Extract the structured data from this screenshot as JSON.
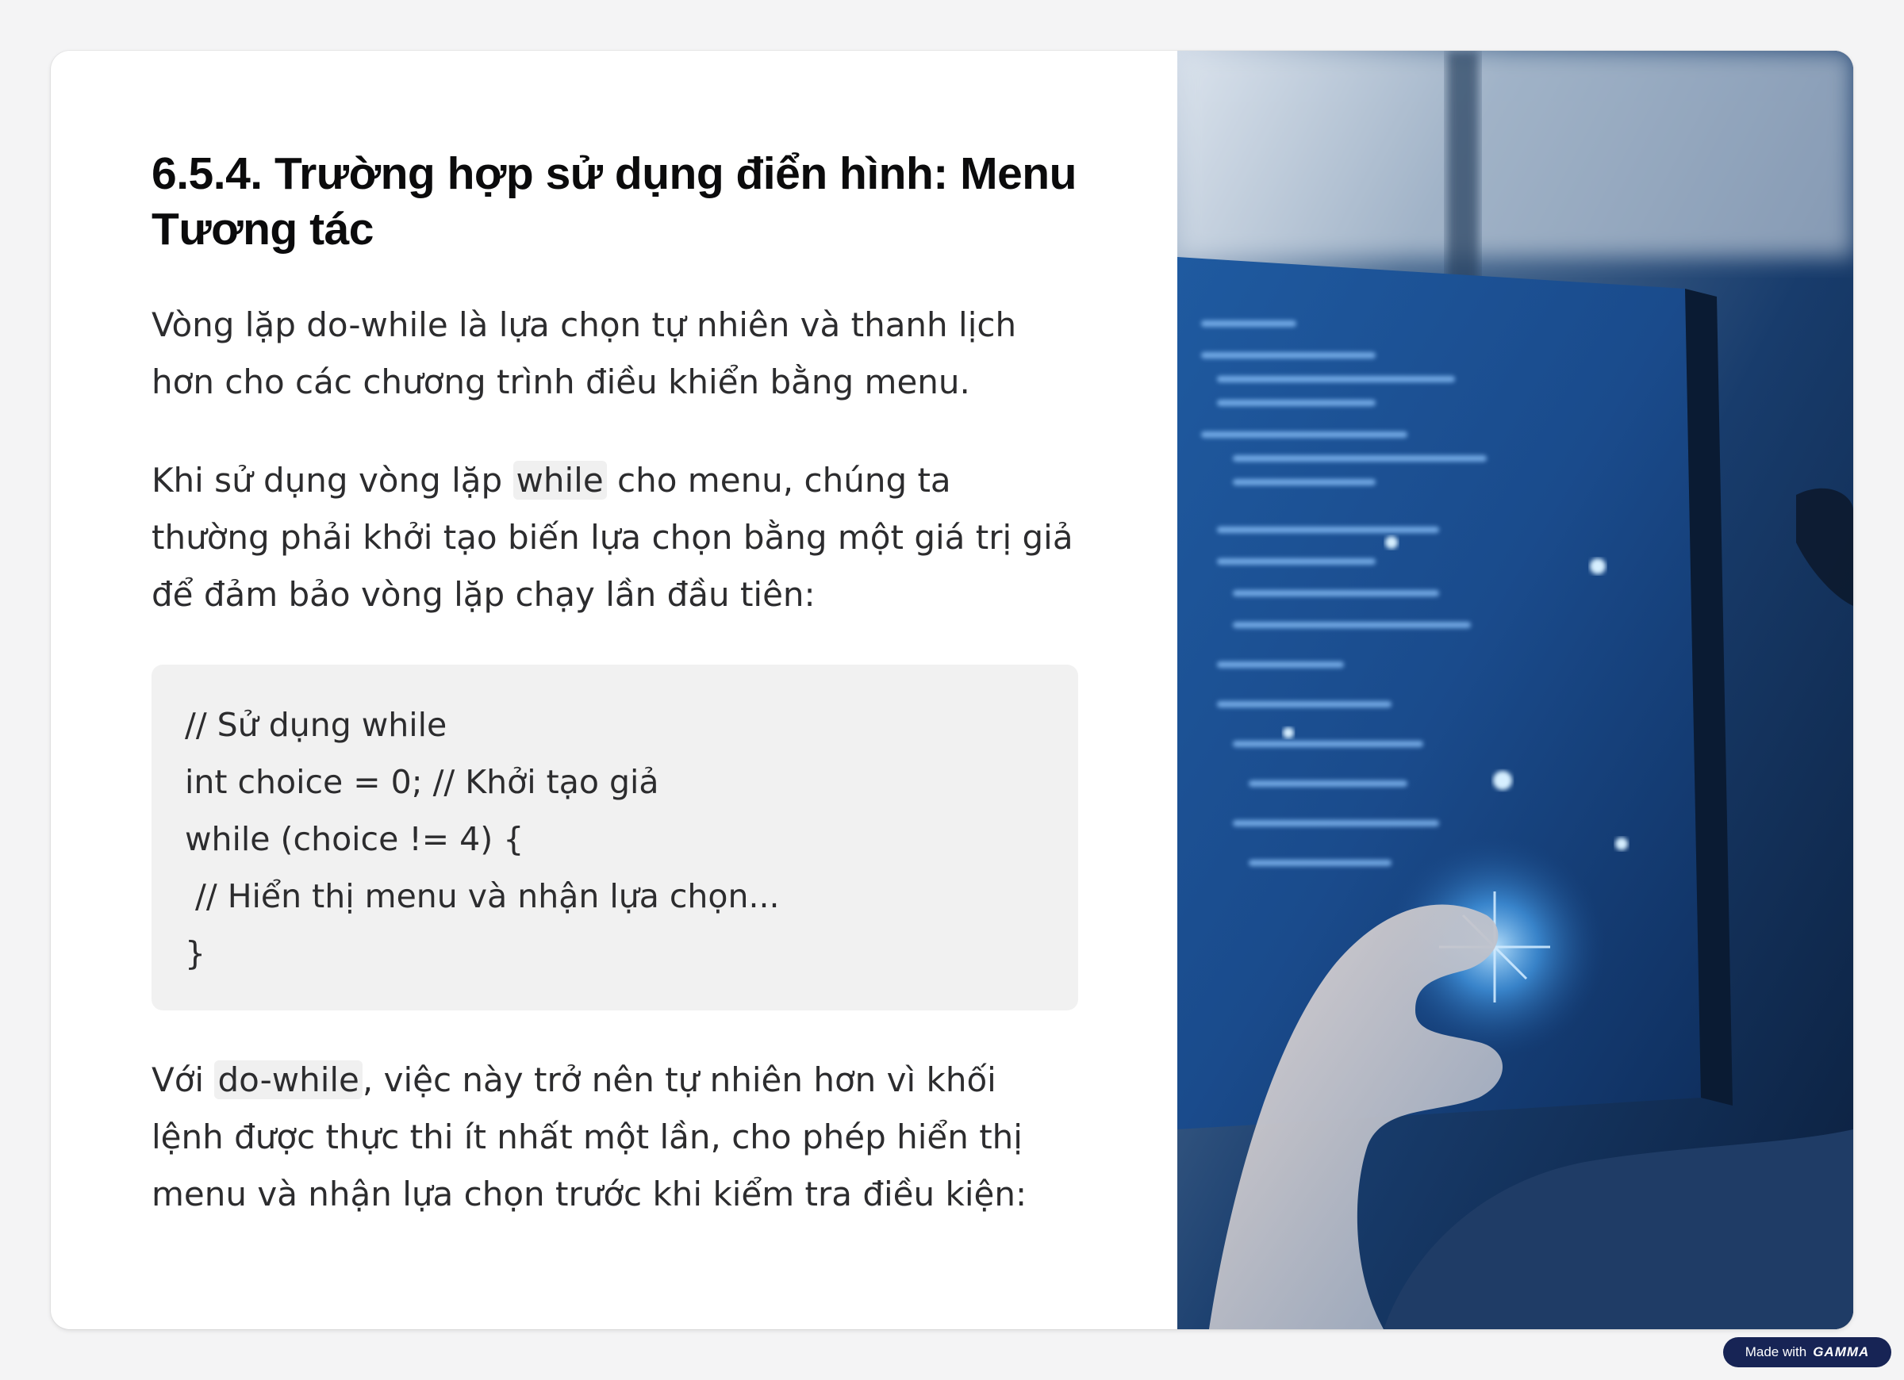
{
  "slide": {
    "title": "6.5.4. Trường hợp sử dụng điển hình: Menu Tương tác",
    "paragraph1": "Vòng lặp do-while là lựa chọn tự nhiên và thanh lịch hơn cho các chương trình điều khiển bằng menu.",
    "paragraph2": {
      "before": "Khi sử dụng vòng lặp ",
      "code": "while",
      "after": " cho menu, chúng ta thường phải khởi tạo biến lựa chọn bằng một giá trị giả để đảm bảo vòng lặp chạy lần đầu tiên:"
    },
    "code_lines": [
      "// Sử dụng while",
      "int choice = 0; // Khởi tạo giả",
      "while (choice != 4) {",
      " // Hiển thị menu và nhận lựa chọn...",
      "}"
    ],
    "paragraph3": {
      "before": "Với ",
      "code": "do-while",
      "after": ", việc này trở nên tự nhiên hơn vì khối lệnh được thực thi ít nhất một lần, cho phép hiển thị menu và nhận lựa chọn trước khi kiểm tra điều kiện:"
    }
  },
  "image": {
    "description_icon": "hand-touching-screen-image"
  },
  "badge": {
    "prefix": "Made with",
    "brand": "GAMMA"
  },
  "colors": {
    "background": "#f4f4f5",
    "card": "#ffffff",
    "code_bg": "#f1f1f1",
    "text": "#2c2c2e",
    "badge_bg": "#172455"
  }
}
